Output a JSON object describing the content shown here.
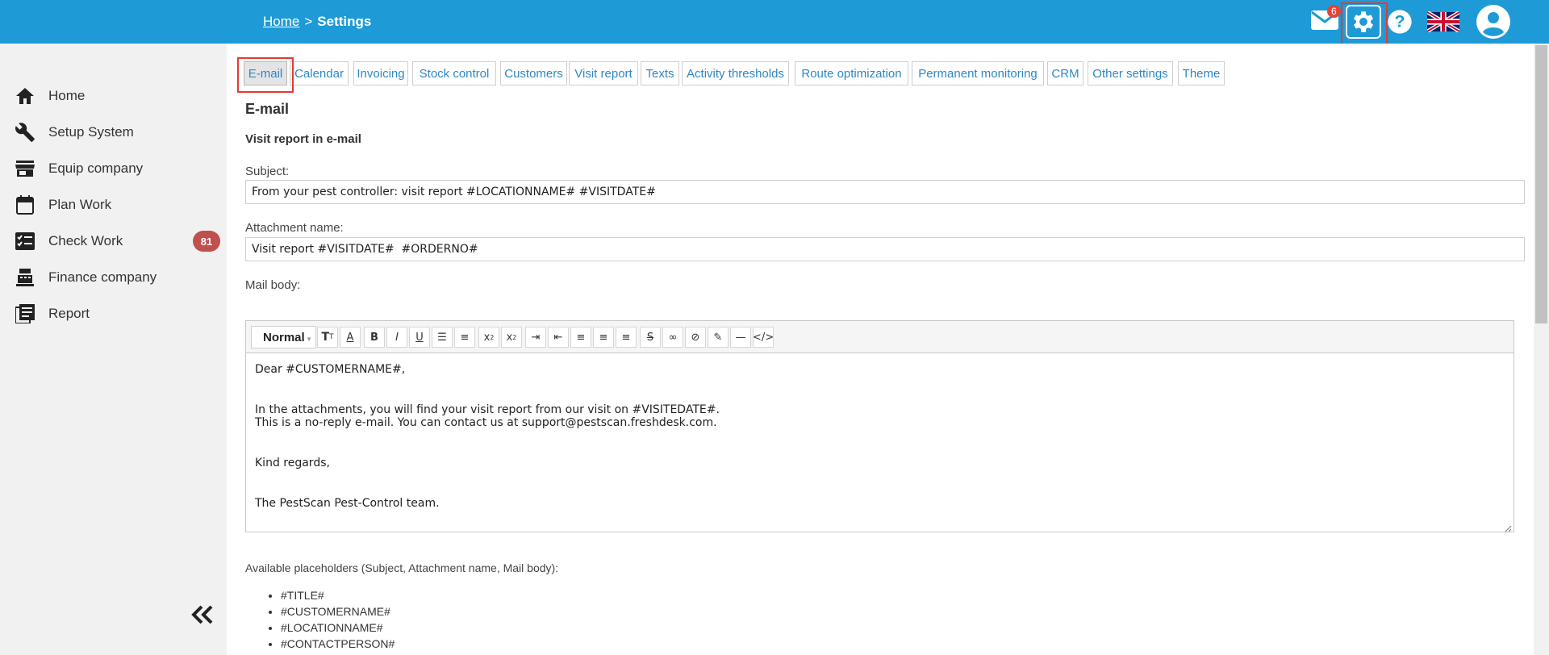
{
  "breadcrumb": {
    "home": "Home",
    "separator": ">",
    "current": "Settings"
  },
  "header": {
    "mail_count": "6"
  },
  "sidebar": {
    "items": [
      {
        "label": "Home",
        "icon": "home-icon"
      },
      {
        "label": "Setup System",
        "icon": "wrench-icon"
      },
      {
        "label": "Equip company",
        "icon": "store-icon"
      },
      {
        "label": "Plan Work",
        "icon": "calendar-icon"
      },
      {
        "label": "Check Work",
        "icon": "checklist-icon",
        "badge": "81"
      },
      {
        "label": "Finance company",
        "icon": "cash-register-icon"
      },
      {
        "label": "Report",
        "icon": "report-icon"
      }
    ]
  },
  "tabs": [
    "E-mail",
    "Calendar",
    "Invoicing",
    "Stock control",
    "Customers",
    "Visit report",
    "Texts",
    "Activity thresholds",
    "Route optimization",
    "Permanent monitoring",
    "CRM",
    "Other settings",
    "Theme"
  ],
  "section": {
    "title": "E-mail",
    "subtitle": "Visit report in e-mail",
    "subject_label": "Subject:",
    "subject_value": "From your pest controller: visit report #LOCATIONNAME# #VISITDATE#",
    "attachment_label": "Attachment name:",
    "attachment_value": "Visit report #VISITDATE#  #ORDERNO#",
    "body_label": "Mail body:"
  },
  "editor": {
    "style_select": "Normal",
    "body_lines": [
      "Dear #CUSTOMERNAME#,",
      "",
      "In the attachments, you will find your visit report from our visit on #VISITEDATE#.",
      "This is a no-reply e-mail. You can contact us at support@pestscan.freshdesk.com.",
      "",
      "Kind regards,",
      "",
      "The PestScan Pest-Control team."
    ]
  },
  "placeholders": {
    "label": "Available placeholders (Subject, Attachment name, Mail body):",
    "items": [
      "#TITLE#",
      "#CUSTOMERNAME#",
      "#LOCATIONNAME#",
      "#CONTACTPERSON#"
    ]
  },
  "colors": {
    "header_bg": "#1e9ad6",
    "accent_link": "#2e88c4",
    "highlight": "#e53935",
    "badge": "#c0504d"
  }
}
